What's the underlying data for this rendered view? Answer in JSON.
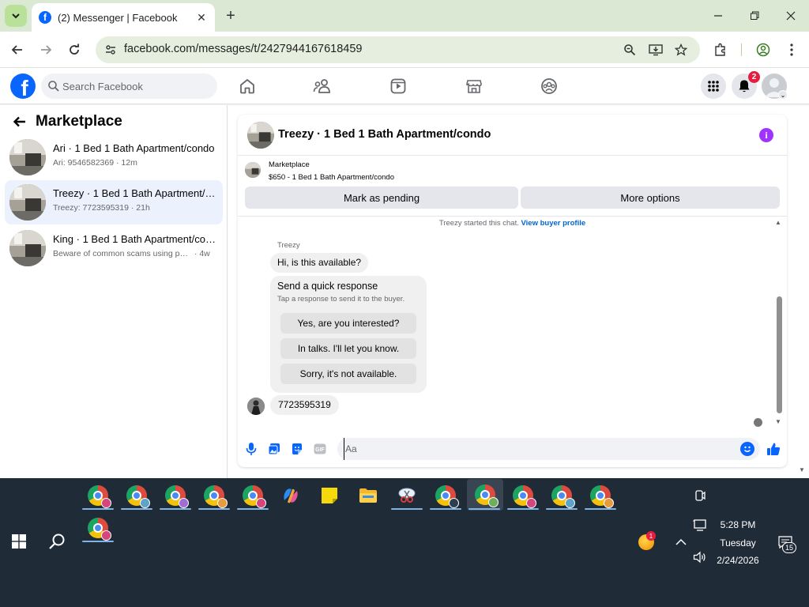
{
  "browser": {
    "tab_title": "(2) Messenger | Facebook",
    "url": "facebook.com/messages/t/2427944167618459"
  },
  "fb": {
    "search_placeholder": "Search Facebook",
    "notifications_count": "2",
    "logo": "f"
  },
  "sidebar": {
    "title": "Marketplace",
    "conversations": [
      {
        "title": "Ari · 1 Bed 1 Bath Apartment/condo",
        "preview": "Ari: 9546582369",
        "time": "· 12m",
        "active": false
      },
      {
        "title": "Treezy · 1 Bed 1 Bath Apartment/c...",
        "preview": "Treezy: 7723595319",
        "time": "· 21h",
        "active": true
      },
      {
        "title": "King · 1 Bed 1 Bath Apartment/con...",
        "preview": "Beware of common scams using pay...",
        "time": "· 4w",
        "active": false
      }
    ]
  },
  "chat": {
    "title": "Treezy · 1 Bed 1 Bath Apartment/condo",
    "info_glyph": "i",
    "listing_source": "Marketplace",
    "listing_price": "$650 - 1 Bed 1 Bath Apartment/condo",
    "mark_pending": "Mark as pending",
    "more_options": "More options",
    "started_text": "Treezy started this chat.",
    "view_buyer_profile": "View buyer profile",
    "sender_name": "Treezy",
    "first_message": "Hi, is this available?",
    "quick_response_title": "Send a quick response",
    "quick_response_sub": "Tap a response to send it to the buyer.",
    "quick_responses": [
      "Yes, are you interested?",
      "In talks. I'll let you know.",
      "Sorry, it's not available."
    ],
    "last_message": "7723595319",
    "composer_placeholder": "Aa"
  },
  "taskbar": {
    "time": "5:28 PM",
    "day": "Tuesday",
    "date": "2/24/2026",
    "notification_count": "15",
    "tray_badge": "1"
  },
  "colors": {
    "facebook_blue": "#0866ff",
    "active_conversation": "#ebf2fe",
    "notification_red": "#e41e3f",
    "info_purple": "#a033ff",
    "taskbar": "#202b38"
  }
}
